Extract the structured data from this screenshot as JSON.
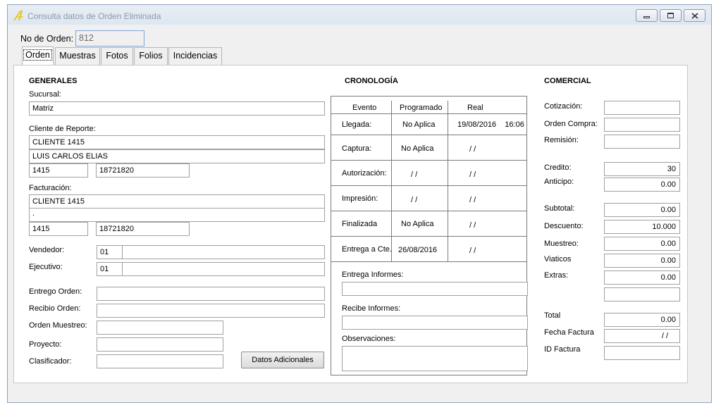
{
  "window": {
    "title": "Consulta datos de Orden Eliminada"
  },
  "header": {
    "order_label": "No de Orden:",
    "order_value": "812"
  },
  "tabs": [
    "Orden",
    "Muestras",
    "Fotos",
    "Folios",
    "Incidencias"
  ],
  "generales": {
    "title": "GENERALES",
    "sucursal_label": "Sucursal:",
    "sucursal": "Matriz",
    "cliente_label": "Cliente de Reporte:",
    "cliente_1": "CLIENTE 1415",
    "cliente_2": "LUIS CARLOS ELIAS",
    "cliente_num": "1415",
    "cliente_tel": "18721820",
    "facturacion_label": "Facturación:",
    "fact_1": "CLIENTE 1415",
    "fact_2": ".",
    "fact_num": "1415",
    "fact_tel": "18721820",
    "vendedor_label": "Vendedor:",
    "vendedor_code": "01",
    "vendedor_name": "",
    "ejecutivo_label": "Ejecutivo:",
    "ejecutivo_code": "01",
    "ejecutivo_name": "",
    "entrego_label": "Entrego Orden:",
    "recibio_label": "Recibio Orden:",
    "orden_muestreo_label": "Orden Muestreo:",
    "proyecto_label": "Proyecto:",
    "clasificador_label": "Clasificador:",
    "datos_button": "Datos Adicionales"
  },
  "cronologia": {
    "title": "CRONOLOGÍA",
    "headers": [
      "Evento",
      "Programado",
      "Real"
    ],
    "rows": [
      {
        "evento": "Llegada:",
        "programado": "No Aplica",
        "real": "19/08/2016    16:06"
      },
      {
        "evento": "Captura:",
        "programado": "No Aplica",
        "real": "/ /"
      },
      {
        "evento": "Autorización:",
        "programado": "/ /",
        "real": "/ /"
      },
      {
        "evento": "Impresión:",
        "programado": "/ /",
        "real": "/ /"
      },
      {
        "evento": "Finalizada",
        "programado": "No Aplica",
        "real": "/ /"
      },
      {
        "evento": "Entrega a Cte.",
        "programado": "26/08/2016",
        "real": "/ /"
      }
    ],
    "entrega_informes_label": "Entrega Informes:",
    "recibe_informes_label": "Recibe Informes:",
    "observaciones_label": "Observaciones:"
  },
  "comercial": {
    "title": "COMERCIAL",
    "cotizacion_label": "Cotización:",
    "orden_compra_label": "Orden Compra:",
    "remision_label": "Remisión:",
    "credito_label": "Credito:",
    "credito": "30",
    "anticipo_label": "Anticipo:",
    "anticipo": "0.00",
    "subtotal_label": "Subtotal:",
    "subtotal": "0.00",
    "descuento_label": "Descuento:",
    "descuento": "10.000",
    "muestreo_label": "Muestreo:",
    "muestreo": "0.00",
    "viaticos_label": "Viaticos",
    "viaticos": "0.00",
    "extras_label": "Extras:",
    "extras": "0.00",
    "total_label": "Total",
    "total": "0.00",
    "fecha_factura_label": "Fecha Factura",
    "fecha_factura": "/ /",
    "id_factura_label": "ID Factura"
  }
}
